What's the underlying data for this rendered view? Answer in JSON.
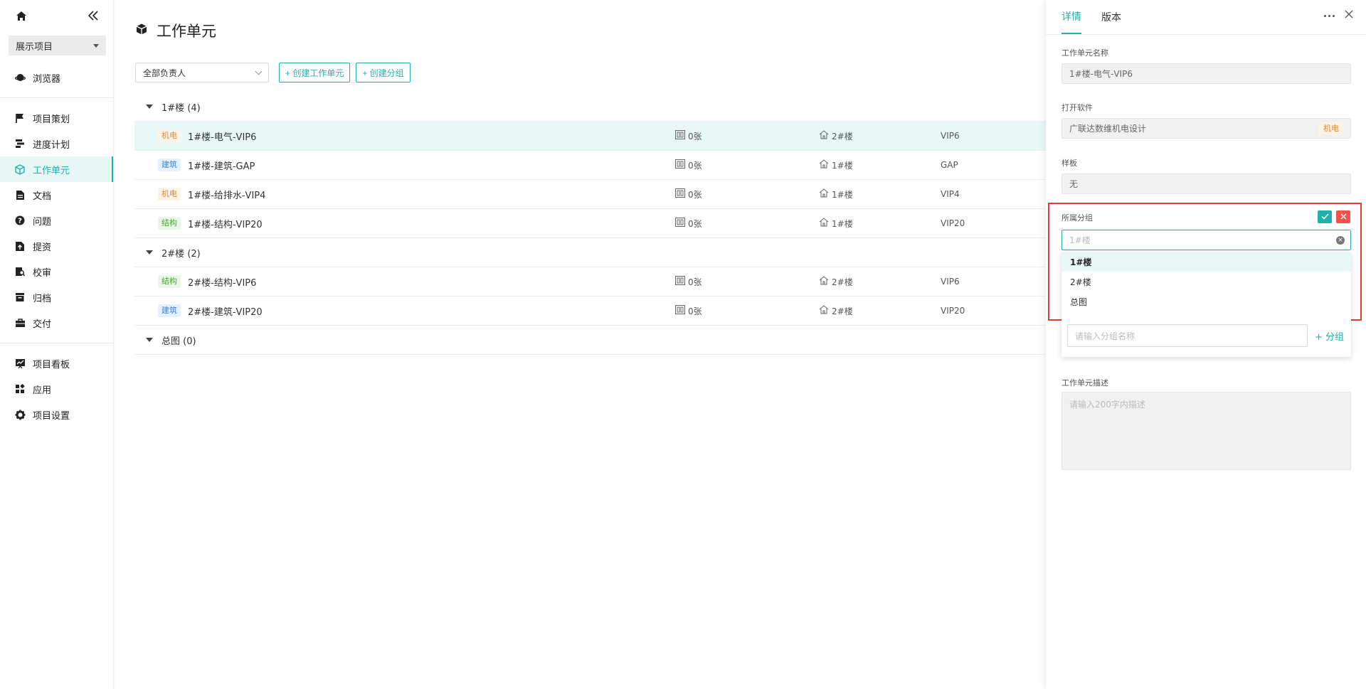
{
  "sidebar": {
    "project_select": "展示项目",
    "items_group1": [
      {
        "label": "浏览器",
        "icon": "planet-icon"
      }
    ],
    "items_group2": [
      {
        "label": "项目策划",
        "icon": "flag-icon"
      },
      {
        "label": "进度计划",
        "icon": "gantt-icon"
      },
      {
        "label": "工作单元",
        "icon": "cube-icon"
      },
      {
        "label": "文档",
        "icon": "document-icon"
      },
      {
        "label": "问题",
        "icon": "question-icon"
      },
      {
        "label": "提资",
        "icon": "upload-icon"
      },
      {
        "label": "校审",
        "icon": "review-icon"
      },
      {
        "label": "归档",
        "icon": "archive-icon"
      },
      {
        "label": "交付",
        "icon": "briefcase-icon"
      }
    ],
    "items_group3": [
      {
        "label": "项目看板",
        "icon": "dashboard-icon"
      },
      {
        "label": "应用",
        "icon": "apps-icon"
      },
      {
        "label": "项目设置",
        "icon": "gear-icon"
      }
    ]
  },
  "main": {
    "title": "工作单元",
    "owner_filter": "全部负责人",
    "create_unit_button": "+ 创建工作单元",
    "create_group_button": "+ 创建分组",
    "groups": [
      {
        "name": "1#楼",
        "count": "(4)",
        "rows": [
          {
            "tag": "机电",
            "tagType": "jd",
            "name": "1#楼-电气-VIP6",
            "pages": "0张",
            "building": "2#楼",
            "code": "VIP6"
          },
          {
            "tag": "建筑",
            "tagType": "jz",
            "name": "1#楼-建筑-GAP",
            "pages": "0张",
            "building": "1#楼",
            "code": "GAP"
          },
          {
            "tag": "机电",
            "tagType": "jd",
            "name": "1#楼-给排水-VIP4",
            "pages": "0张",
            "building": "1#楼",
            "code": "VIP4"
          },
          {
            "tag": "结构",
            "tagType": "jg",
            "name": "1#楼-结构-VIP20",
            "pages": "0张",
            "building": "1#楼",
            "code": "VIP20"
          }
        ]
      },
      {
        "name": "2#楼",
        "count": "(2)",
        "rows": [
          {
            "tag": "结构",
            "tagType": "jg",
            "name": "2#楼-结构-VIP6",
            "pages": "0张",
            "building": "2#楼",
            "code": "VIP6"
          },
          {
            "tag": "建筑",
            "tagType": "jz",
            "name": "2#楼-建筑-VIP20",
            "pages": "0张",
            "building": "2#楼",
            "code": "VIP20"
          }
        ]
      },
      {
        "name": "总图",
        "count": "(0)",
        "rows": []
      }
    ]
  },
  "panel": {
    "tab_detail": "详情",
    "tab_version": "版本",
    "name_label": "工作单元名称",
    "name_value": "1#楼-电气-VIP6",
    "software_label": "打开软件",
    "software_value": "广联达数维机电设计",
    "software_tag": "机电",
    "template_label": "样板",
    "template_value": "无",
    "group_label": "所属分组",
    "group_input_placeholder": "1#楼",
    "group_options": [
      "1#楼",
      "2#楼",
      "总图"
    ],
    "new_group_placeholder": "请输入分组名称",
    "new_group_button": "+ 分组",
    "desc_label": "工作单元描述",
    "desc_placeholder": "请输入200字内描述"
  },
  "colors": {
    "accent": "#20b2aa",
    "danger": "#f0524f",
    "highlight": "#e53935"
  }
}
